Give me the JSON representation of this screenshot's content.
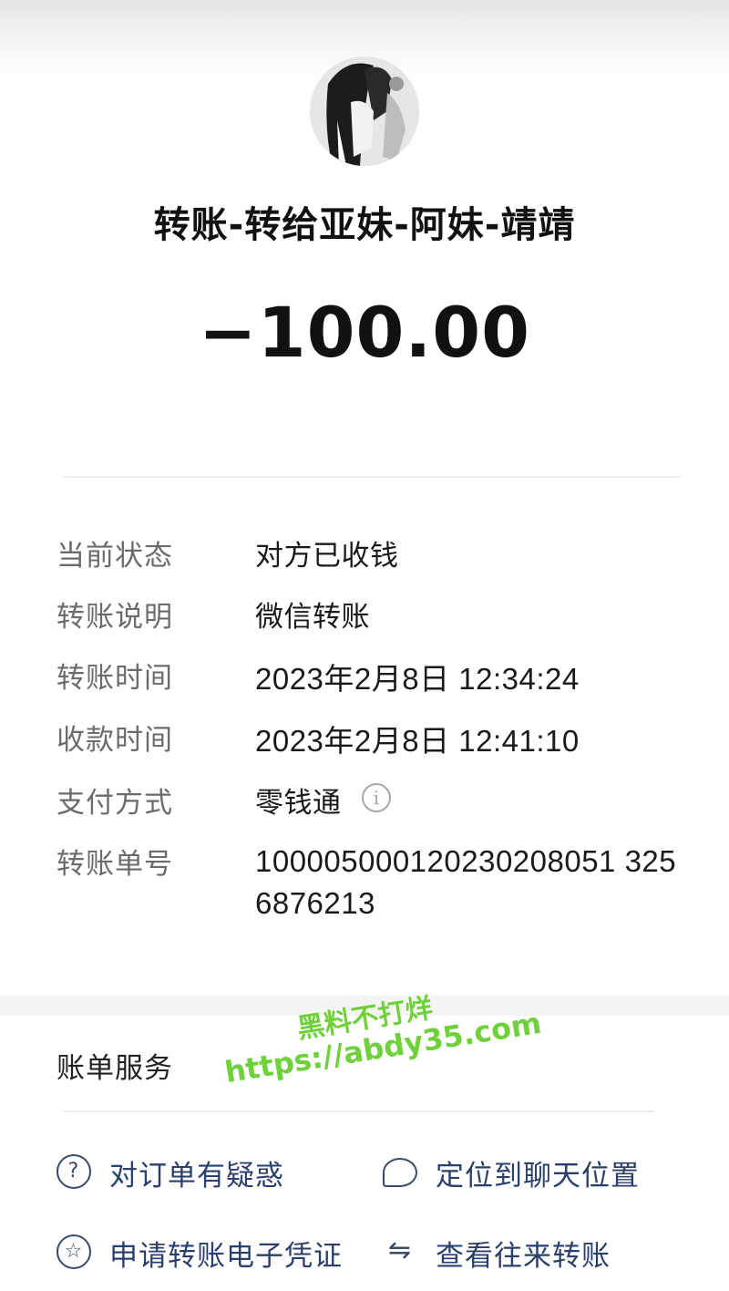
{
  "header": {
    "title": "转账-转给亚妹-阿妹-靖靖",
    "amount": "−100.00"
  },
  "details": [
    {
      "label": "当前状态",
      "value": "对方已收钱"
    },
    {
      "label": "转账说明",
      "value": "微信转账"
    },
    {
      "label": "转账时间",
      "value": "2023年2月8日 12:34:24"
    },
    {
      "label": "收款时间",
      "value": "2023年2月8日 12:41:10"
    },
    {
      "label": "支付方式",
      "value": "零钱通",
      "icon": "info-icon"
    },
    {
      "label": "转账单号",
      "value": "10000500012023020805132568762 13"
    }
  ],
  "transaction_no": "100005000120230208051 3256876213",
  "services": {
    "title": "账单服务",
    "items": [
      {
        "label": "对订单有疑惑",
        "icon": "question-icon"
      },
      {
        "label": "定位到聊天位置",
        "icon": "chat-bubble-icon"
      },
      {
        "label": "申请转账电子凭证",
        "icon": "star-badge-icon"
      },
      {
        "label": "查看往来转账",
        "icon": "swap-arrows-icon"
      }
    ]
  },
  "watermark": {
    "line1": "黑料不打烊",
    "line2": "https://abdy35.com"
  },
  "colors": {
    "service_text": "#2a3f6b",
    "watermark": "#6fd13a"
  }
}
